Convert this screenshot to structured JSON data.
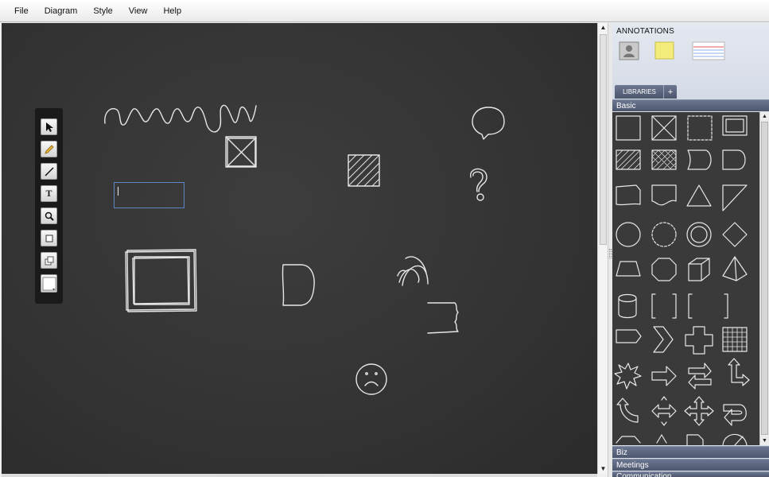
{
  "menu": [
    "File",
    "Diagram",
    "Style",
    "View",
    "Help"
  ],
  "toolbar": {
    "tools": [
      "pointer-tool",
      "pencil-tool",
      "line-tool",
      "text-tool",
      "zoom-tool",
      "rectangle-tool",
      "duplicate-tool",
      "color-picker"
    ],
    "text_tool_label": "T"
  },
  "canvas": {
    "editing_text_value": "",
    "shapes": [
      "squiggle-line",
      "crossed-box",
      "hatched-square",
      "speech-bubble",
      "question-mark",
      "double-frame",
      "d-shape",
      "signal-arcs",
      "jagged-edge-box",
      "sad-face"
    ]
  },
  "panel": {
    "annotations_title": "ANNOTATIONS",
    "annotation_items": [
      "user-card-icon",
      "sticky-note-icon",
      "lined-card-icon"
    ],
    "libraries_tab": "LIBRARIES",
    "libraries_add": "+",
    "section_basic": "Basic",
    "section_biz": "Biz",
    "section_meetings": "Meetings",
    "section_communication": "Communication",
    "shapes": [
      "square",
      "crossed-square",
      "dashed-square",
      "double-square",
      "hatched-rect",
      "crosshatched-rect",
      "tab-shape",
      "d-shape",
      "wave-top-rect",
      "wave-bottom-rect",
      "triangle",
      "right-triangle",
      "circle",
      "dashed-circle",
      "ring",
      "diamond",
      "trapezoid",
      "octagon",
      "cube",
      "pyramid",
      "cylinder",
      "rounded-bracket-box",
      "left-bracket",
      "right-bracket",
      "tag-shape",
      "chevron",
      "cross",
      "grid-square",
      "starburst",
      "right-arrow",
      "swap-arrows",
      "up-right-turn-arrow",
      "curved-up-arrow",
      "two-way-arrow",
      "four-way-arrow",
      "u-turn-arrow",
      "partial-hexagon",
      "partial-triangle",
      "partial-page",
      "partial-pie"
    ]
  },
  "scroll_arrows": {
    "up": "▲",
    "down": "▼"
  }
}
